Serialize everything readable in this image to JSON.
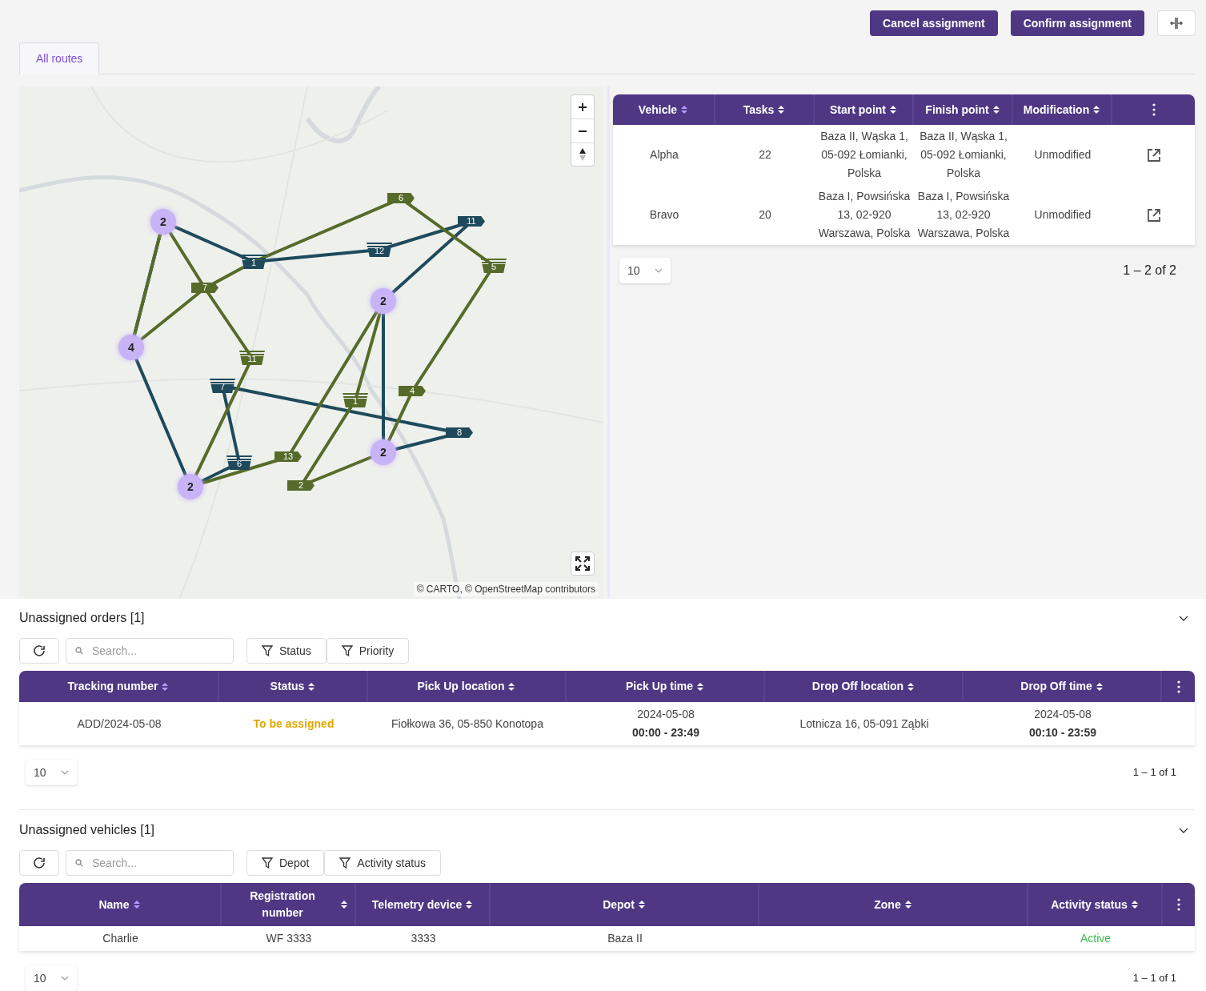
{
  "header": {
    "buttons": [
      "Cancel assignment",
      "Confirm assignment"
    ]
  },
  "tabs": [
    {
      "label": "All routes",
      "selected": true
    }
  ],
  "map": {
    "attribution": "© CARTO, © OpenStreetMap contributors",
    "routes": [
      {
        "color": "#1e4a5c",
        "stops": [
          {
            "label": "1",
            "kind": "stack"
          },
          {
            "label": "12",
            "kind": "stack"
          },
          {
            "label": "11",
            "kind": "flag"
          },
          {
            "label": "7",
            "kind": "stack"
          },
          {
            "label": "6",
            "kind": "stack"
          },
          {
            "label": "8",
            "kind": "flag"
          }
        ]
      },
      {
        "color": "#566b2a",
        "stops": [
          {
            "label": "6",
            "kind": "flag"
          },
          {
            "label": "5",
            "kind": "stack"
          },
          {
            "label": "7",
            "kind": "flag"
          },
          {
            "label": "11",
            "kind": "stack"
          },
          {
            "label": "1",
            "kind": "stack"
          },
          {
            "label": "4",
            "kind": "flag"
          },
          {
            "label": "13",
            "kind": "flag"
          },
          {
            "label": "2",
            "kind": "flag"
          }
        ]
      }
    ],
    "clusters": [
      "2",
      "4",
      "2",
      "2",
      "2"
    ]
  },
  "routes_table": {
    "columns": [
      {
        "label": "Vehicle",
        "sorted": true
      },
      {
        "label": "Tasks",
        "sorted": false
      },
      {
        "label": "Start point",
        "sorted": false
      },
      {
        "label": "Finish point",
        "sorted": false
      },
      {
        "label": "Modification",
        "sorted": false
      }
    ],
    "rows": [
      [
        {
          "kind": "text",
          "text": "Alpha"
        },
        {
          "kind": "text",
          "text": "22"
        },
        {
          "kind": "text",
          "text": "Baza II, Wąska 1, 05-092 Łomianki, Polska"
        },
        {
          "kind": "text",
          "text": "Baza II, Wąska 1, 05-092 Łomianki, Polska"
        },
        {
          "kind": "text",
          "text": "Unmodified"
        },
        {
          "kind": "open"
        }
      ],
      [
        {
          "kind": "text",
          "text": "Bravo"
        },
        {
          "kind": "text",
          "text": "20"
        },
        {
          "kind": "text",
          "text": "Baza I, Powsińska 13, 02-920 Warszawa, Polska"
        },
        {
          "kind": "text",
          "text": "Baza I, Powsińska 13, 02-920 Warszawa, Polska"
        },
        {
          "kind": "text",
          "text": "Unmodified"
        },
        {
          "kind": "open"
        }
      ]
    ],
    "page_size": "10",
    "range": "1 – 2 of 2"
  },
  "sections": [
    {
      "title": "Unassigned orders [1]",
      "search_placeholder": "Search...",
      "filters": [
        "Status",
        "Priority"
      ],
      "columns": [
        {
          "label": "Tracking number",
          "sorted": true
        },
        {
          "label": "Status",
          "sorted": false
        },
        {
          "label": "Pick Up location",
          "sorted": false
        },
        {
          "label": "Pick Up time",
          "sorted": false
        },
        {
          "label": "Drop Off location",
          "sorted": false
        },
        {
          "label": "Drop Off time",
          "sorted": false
        }
      ],
      "rows": [
        [
          {
            "kind": "text",
            "text": "ADD/2024-05-08"
          },
          {
            "kind": "status",
            "text": "To be assigned",
            "color": "#e0a800"
          },
          {
            "kind": "text",
            "text": "Fiołkowa 36, 05-850 Konotopa"
          },
          {
            "kind": "datetime",
            "date": "2024-05-08",
            "time": "00:00 - 23:49"
          },
          {
            "kind": "text",
            "text": "Lotnicza 16, 05-091 Ząbki"
          },
          {
            "kind": "datetime",
            "date": "2024-05-08",
            "time": "00:10 - 23:59"
          }
        ]
      ],
      "page_size": "10",
      "range": "1 – 1 of 1"
    },
    {
      "title": "Unassigned vehicles [1]",
      "search_placeholder": "Search...",
      "filters": [
        "Depot",
        "Activity status"
      ],
      "columns": [
        {
          "label": "Name",
          "sorted": true
        },
        {
          "label": "Registration number",
          "sorted": false
        },
        {
          "label": "Telemetry device",
          "sorted": false
        },
        {
          "label": "Depot",
          "sorted": false
        },
        {
          "label": "Zone",
          "sorted": false
        },
        {
          "label": "Activity status",
          "sorted": false
        }
      ],
      "rows": [
        [
          {
            "kind": "text",
            "text": "Charlie"
          },
          {
            "kind": "text",
            "text": "WF 3333"
          },
          {
            "kind": "text",
            "text": "3333"
          },
          {
            "kind": "text",
            "text": "Baza II"
          },
          {
            "kind": "empty"
          },
          {
            "kind": "status",
            "text": "Active",
            "color": "#3dba4e"
          }
        ]
      ],
      "page_size": "10",
      "range": "1 – 1 of 1"
    }
  ]
}
